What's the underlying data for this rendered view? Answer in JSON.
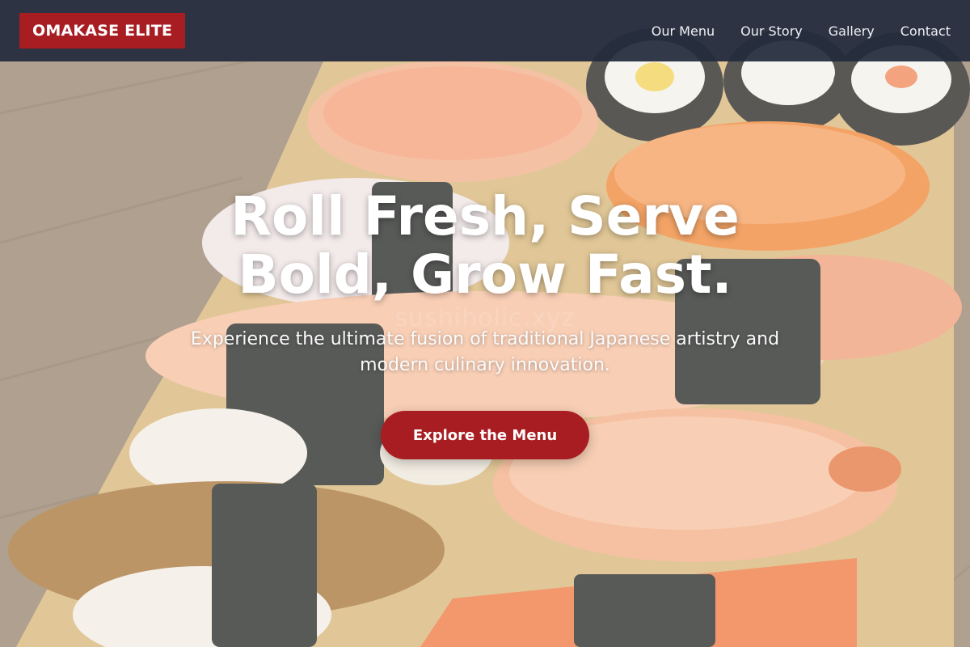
{
  "brand": {
    "logo_text": "OMAKASE ELITE"
  },
  "nav": {
    "items": [
      {
        "label": "Our Menu"
      },
      {
        "label": "Our Story"
      },
      {
        "label": "Gallery"
      },
      {
        "label": "Contact"
      }
    ]
  },
  "hero": {
    "title": "Roll Fresh, Serve Bold, Grow Fast.",
    "subtitle": "Experience the ultimate fusion of traditional Japanese artistry and modern culinary innovation.",
    "cta_label": "Explore the Menu",
    "watermark": "sushiholic.xyz",
    "background_image": "sushi-platter-photo"
  },
  "colors": {
    "accent": "#a81d22",
    "navbar": "#222b3c",
    "text_on_dark": "#ffffff"
  }
}
